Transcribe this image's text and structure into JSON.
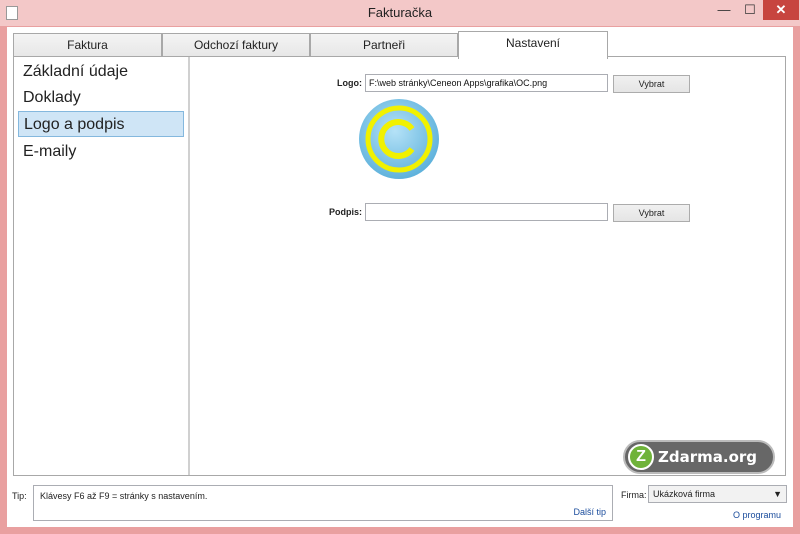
{
  "window": {
    "title": "Fakturačka",
    "minimize": "—",
    "maximize": "☐",
    "close": "✕"
  },
  "tabs": [
    {
      "label": "Faktura"
    },
    {
      "label": "Odchozí faktury"
    },
    {
      "label": "Partneři"
    },
    {
      "label": "Nastavení"
    }
  ],
  "sidebar": {
    "items": [
      {
        "label": "Základní údaje"
      },
      {
        "label": "Doklady"
      },
      {
        "label": "Logo a podpis"
      },
      {
        "label": "E-maily"
      }
    ]
  },
  "form": {
    "logo_label": "Logo:",
    "logo_value": "F:\\web stránky\\Ceneon Apps\\grafika\\OC.png",
    "logo_button": "Vybrat",
    "signature_label": "Podpis:",
    "signature_value": "",
    "signature_button": "Vybrat"
  },
  "logo_preview": {
    "icon": "copyright-logo",
    "ring_color": "#f1f100",
    "fill_color": "#8ecbea"
  },
  "footer": {
    "tip_label": "Tip:",
    "tip_text": "Klávesy F6 až F9 = stránky s nastavením.",
    "next_tip": "Další tip",
    "firma_label": "Firma:",
    "firma_value": "Ukázková firma",
    "about": "O programu"
  },
  "watermark": {
    "text": "Zdarma.org",
    "badge": "Z"
  }
}
